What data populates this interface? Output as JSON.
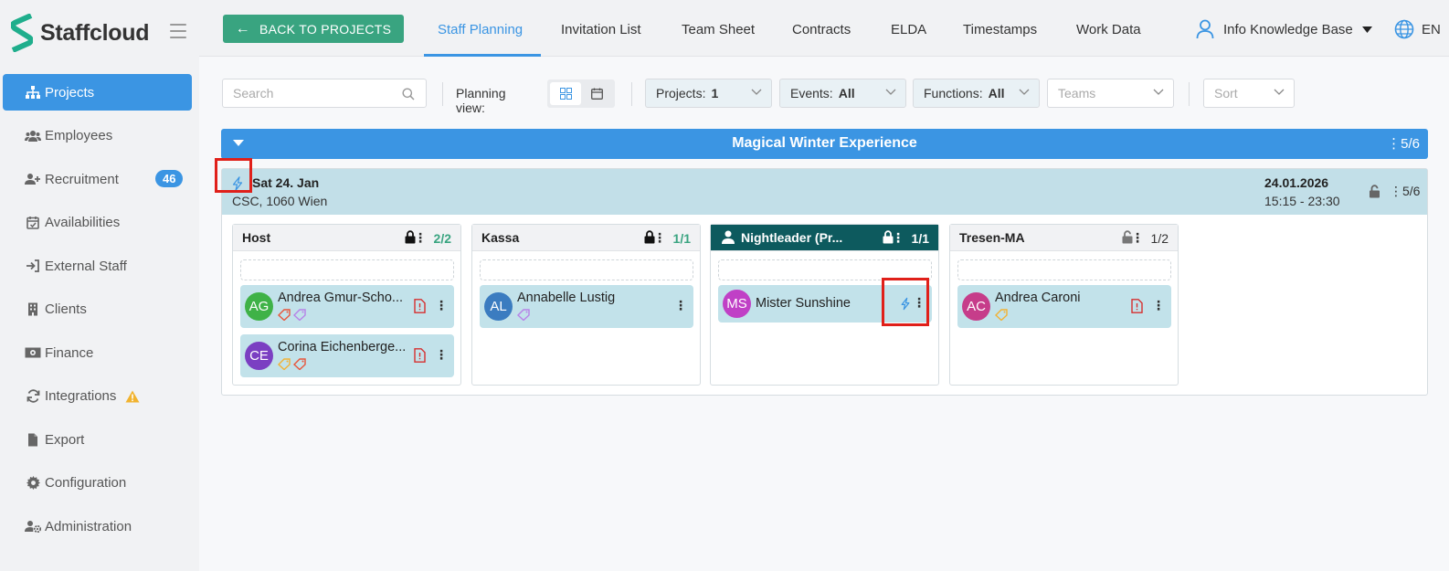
{
  "app": {
    "name": "Staffcloud"
  },
  "sidebar": {
    "items": [
      {
        "label": "Projects",
        "icon": "sitemap-icon"
      },
      {
        "label": "Employees",
        "icon": "users-icon"
      },
      {
        "label": "Recruitment",
        "icon": "user-plus-icon",
        "badge": "46"
      },
      {
        "label": "Availabilities",
        "icon": "calendar-check-icon"
      },
      {
        "label": "External Staff",
        "icon": "sign-in-icon"
      },
      {
        "label": "Clients",
        "icon": "building-icon"
      },
      {
        "label": "Finance",
        "icon": "money-icon"
      },
      {
        "label": "Integrations",
        "icon": "sync-icon",
        "warning": true
      },
      {
        "label": "Export",
        "icon": "file-icon"
      },
      {
        "label": "Configuration",
        "icon": "gear-icon"
      },
      {
        "label": "Administration",
        "icon": "user-cog-icon"
      }
    ]
  },
  "topbar": {
    "back_label": "BACK TO PROJECTS",
    "tabs": [
      "Staff Planning",
      "Invitation List",
      "Team Sheet",
      "Contracts",
      "ELDA",
      "Timestamps",
      "Work Data"
    ],
    "active_tab": "Staff Planning",
    "user_name": "Info Knowledge Base",
    "language": "EN"
  },
  "filters": {
    "search_placeholder": "Search",
    "planning_view_label": "Planning view:",
    "projects_label": "Projects:",
    "projects_value": "1",
    "events_label": "Events:",
    "events_value": "All",
    "functions_label": "Functions:",
    "functions_value": "All",
    "teams_placeholder": "Teams",
    "sort_placeholder": "Sort"
  },
  "project": {
    "title": "Magical Winter Experience",
    "count": "5/6"
  },
  "event": {
    "day": "Sat 24. Jan",
    "location": "CSC, 1060 Wien",
    "date": "24.01.2026",
    "time": "15:15 - 23:30",
    "count": "5/6"
  },
  "columns": [
    {
      "title": "Host",
      "count": "2/2",
      "locked": true,
      "cards": [
        {
          "initials": "AG",
          "name": "Andrea Gmur-Scho...",
          "avatar_color": "#3fb247",
          "tags": [
            "#e8553b",
            "#b782e8"
          ],
          "doc": true
        },
        {
          "initials": "CE",
          "name": "Corina Eichenberge...",
          "avatar_color": "#7b3fc2",
          "tags": [
            "#f2b134",
            "#e8553b"
          ],
          "doc": true
        }
      ]
    },
    {
      "title": "Kassa",
      "count": "1/1",
      "locked": true,
      "cards": [
        {
          "initials": "AL",
          "name": "Annabelle Lustig",
          "avatar_color": "#3b7cc0",
          "tags": [
            "#b782e8"
          ],
          "doc": false
        }
      ]
    },
    {
      "title": "Nightleader (Pr...",
      "count": "1/1",
      "locked": true,
      "dark": true,
      "cards": [
        {
          "initials": "MS",
          "name": "Mister Sunshine",
          "avatar_color": "#c040c6",
          "tags": [],
          "doc": false,
          "bolt": true
        }
      ]
    },
    {
      "title": "Tresen-MA",
      "count": "1/2",
      "locked": false,
      "cards": [
        {
          "initials": "AC",
          "name": "Andrea Caroni",
          "avatar_color": "#c63d8a",
          "tags": [
            "#f2b134"
          ],
          "doc": true
        }
      ]
    }
  ],
  "colors": {
    "accent": "#3b95e3",
    "green": "#39a480",
    "teal_dark": "#0d5a5e",
    "highlight": "#e0201a"
  }
}
